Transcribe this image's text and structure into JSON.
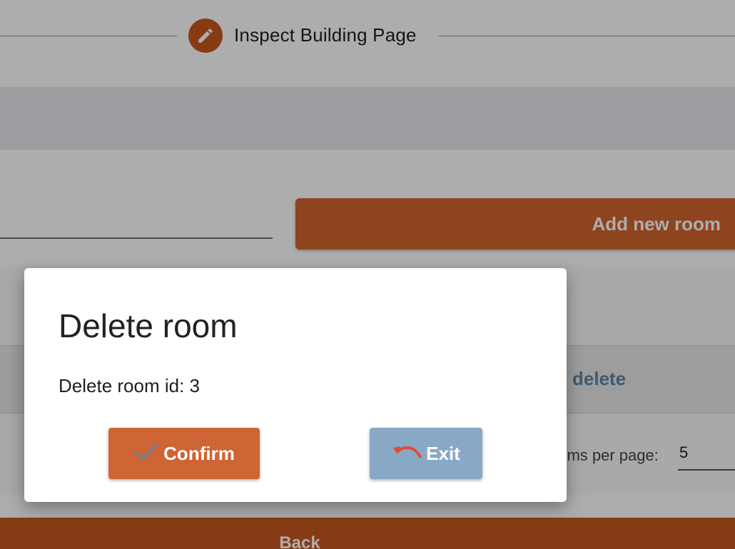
{
  "header": {
    "title": "Inspect Building Page",
    "icon": "pencil-icon",
    "accent": "#c8581f"
  },
  "toolbar": {
    "add_room_label": "Add new room"
  },
  "table": {
    "delete_column": "delete",
    "items_per_page_label": "Items per page:",
    "items_per_page_value": "5"
  },
  "footer": {
    "back_label": "Back"
  },
  "dialog": {
    "title": "Delete room",
    "message": "Delete room id: 3",
    "confirm_label": "Confirm",
    "confirm_icon": "checkmark-icon",
    "exit_label": "Exit",
    "exit_icon": "undo-arrow-icon",
    "confirm_color": "#cf6434",
    "exit_color": "#87a9c6"
  }
}
